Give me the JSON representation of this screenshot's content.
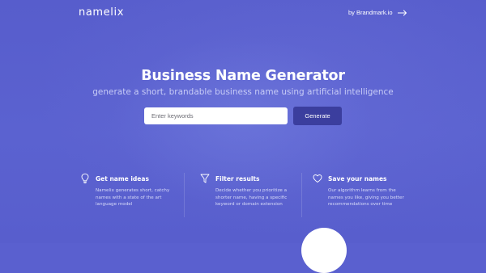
{
  "header": {
    "logo": "namelix",
    "by_link": "by Brandmark.io"
  },
  "hero": {
    "title": "Business Name Generator",
    "subtitle": "generate a short, brandable business name using artificial intelligence"
  },
  "search": {
    "placeholder": "Enter keywords",
    "value": "",
    "button_label": "Generate"
  },
  "features": [
    {
      "icon": "lightbulb-icon",
      "title": "Get name ideas",
      "description": "Namelix generates short, catchy names with a state of the art language model"
    },
    {
      "icon": "filter-icon",
      "title": "Filter results",
      "description": "Decide whether you prioritize a shorter name, having a specific keyword or domain extension"
    },
    {
      "icon": "heart-icon",
      "title": "Save your names",
      "description": "Our algorithm learns from the names you like, giving you better recommendations over time"
    }
  ],
  "colors": {
    "background": "#5a60cf",
    "button": "#3b3e9e",
    "subtitle": "#c7cbf6"
  }
}
